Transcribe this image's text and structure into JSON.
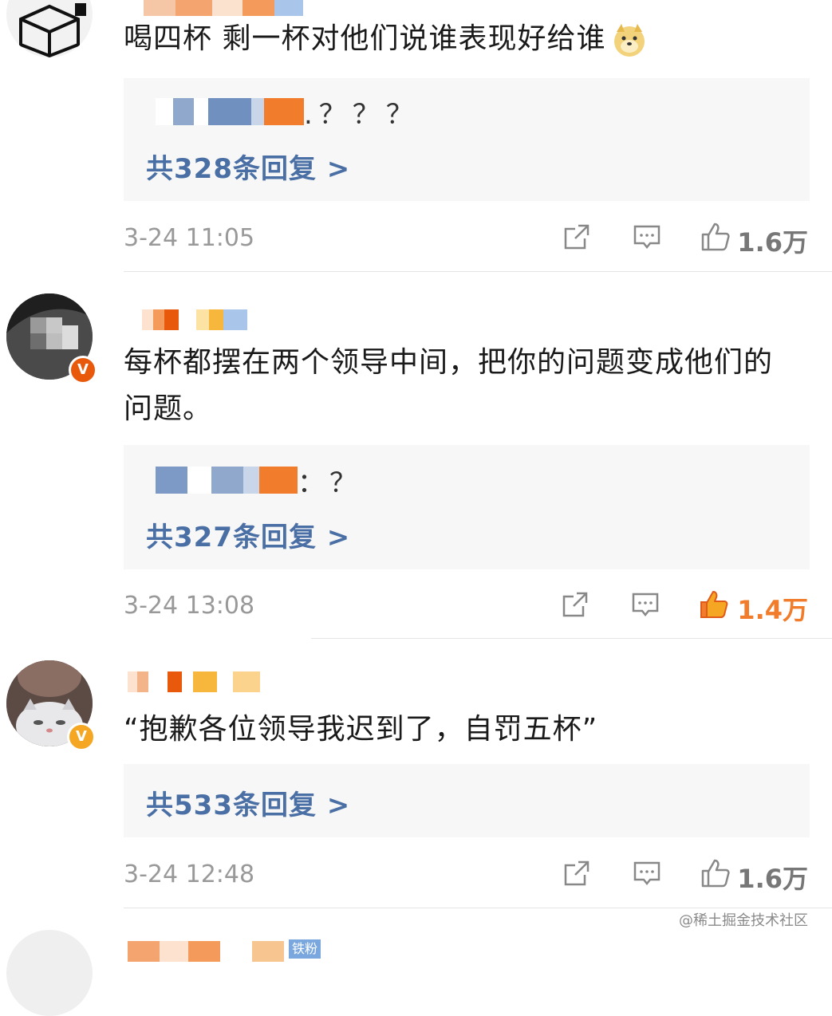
{
  "comments": [
    {
      "text": "喝四杯 剩一杯对他们说谁表现好给谁",
      "emoji": "doge-emoji",
      "reply_preview_suffix": ".？？？",
      "reply_count": "共328条回复 >",
      "time": "3-24 11:05",
      "likes": "1.6万",
      "liked": false
    },
    {
      "text": "每杯都摆在两个领导中间，把你的问题变成他们的问题。",
      "reply_preview_suffix": "：？",
      "reply_count": "共327条回复 >",
      "time": "3-24 13:08",
      "likes": "1.4万",
      "liked": true,
      "badge": "V"
    },
    {
      "text": "“抱歉各位领导我迟到了，自罚五杯”",
      "reply_count": "共533条回复 >",
      "time": "3-24 12:48",
      "likes": "1.6万",
      "liked": false,
      "badge": "V"
    }
  ],
  "watermark": "@稀土掘金技术社区",
  "partial_label": "铁粉",
  "colors": {
    "reply_link": "#4a6fa5",
    "like_active": "#f07c2c",
    "meta_gray": "#999999",
    "reply_bg": "#f7f7f7"
  },
  "icons": {
    "share": "share-icon",
    "comment": "comment-icon",
    "like": "thumbs-up-icon"
  }
}
